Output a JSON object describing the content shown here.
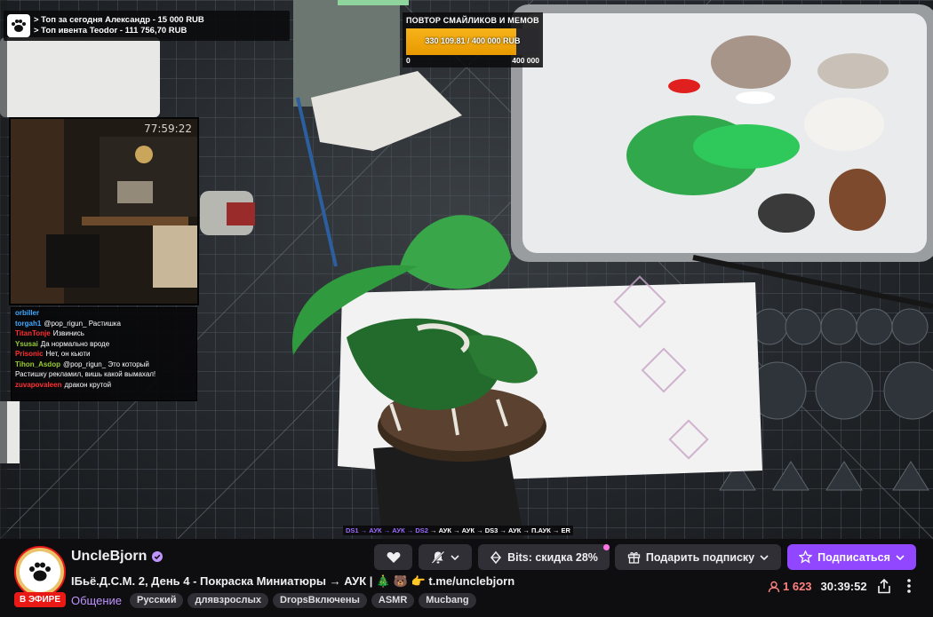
{
  "video": {
    "top_overlay": {
      "line1": "> Топ за сегодня Александр - 15 000 RUB",
      "line2": "> Топ ивента  Teodor - 111 756,70 RUB"
    },
    "goal": {
      "title": "ПОВТОР СМАЙЛИКОВ И МЕМОВ",
      "value_text": "330 109.81 / 400 000 RUB",
      "progress": 0.825,
      "min_label": "0",
      "max_label": "400 000"
    },
    "webcam": {
      "timer": "77:59:22"
    },
    "chat": [
      {
        "nick": "orbiller",
        "text": "",
        "color": "#3fa9ff"
      },
      {
        "nick": "torgah1",
        "text": "@pop_rigun_ Растишка",
        "color": "#3fa9ff"
      },
      {
        "nick": "",
        "text": "",
        "color": "#9aa0a6"
      },
      {
        "nick": "TitanTonje",
        "text": "Извинись",
        "color": "#ff3030"
      },
      {
        "nick": "Ysusai",
        "text": "Да нормально вроде",
        "color": "#9acd32"
      },
      {
        "nick": "Prisonic",
        "text": "Нет, он кьюти",
        "color": "#ff3030"
      },
      {
        "nick": "Tihon_Asdop",
        "text": "@pop_rigun_ Это который",
        "color": "#9acd32"
      },
      {
        "nick": "",
        "text": "Растишку рекламил, вишь какой вымахал!",
        "color": "#ffffff"
      },
      {
        "nick": "zuvapovaleen",
        "text": "дракон крутой",
        "color": "#ff3030"
      }
    ],
    "markers": {
      "done": "DS1 → АУК → АУК → DS2",
      "todo": " → АУК → АУК → DS3 → АУК → П.АУК → ER"
    }
  },
  "channel": {
    "name": "UncleBjorn",
    "live_badge": "В ЭФИРЕ",
    "title": "IБьё.Д.С.М. 2, День 4 - Покраска Миниатюры → АУК | 🎄 🐻 👉 t.me/unclebjorn",
    "category": "Общение",
    "tags": [
      "Русский",
      "длявзрослых",
      "DropsВключены",
      "ASMR",
      "Mucbang"
    ],
    "viewers": "1 623",
    "uptime": "30:39:52"
  },
  "actions": {
    "bits_label": "Bits: скидка 28%",
    "gift_label": "Подарить подписку",
    "subscribe_label": "Подписаться"
  },
  "colors": {
    "accent": "#9147ff",
    "live": "#e91916",
    "viewers": "#ff8280"
  }
}
